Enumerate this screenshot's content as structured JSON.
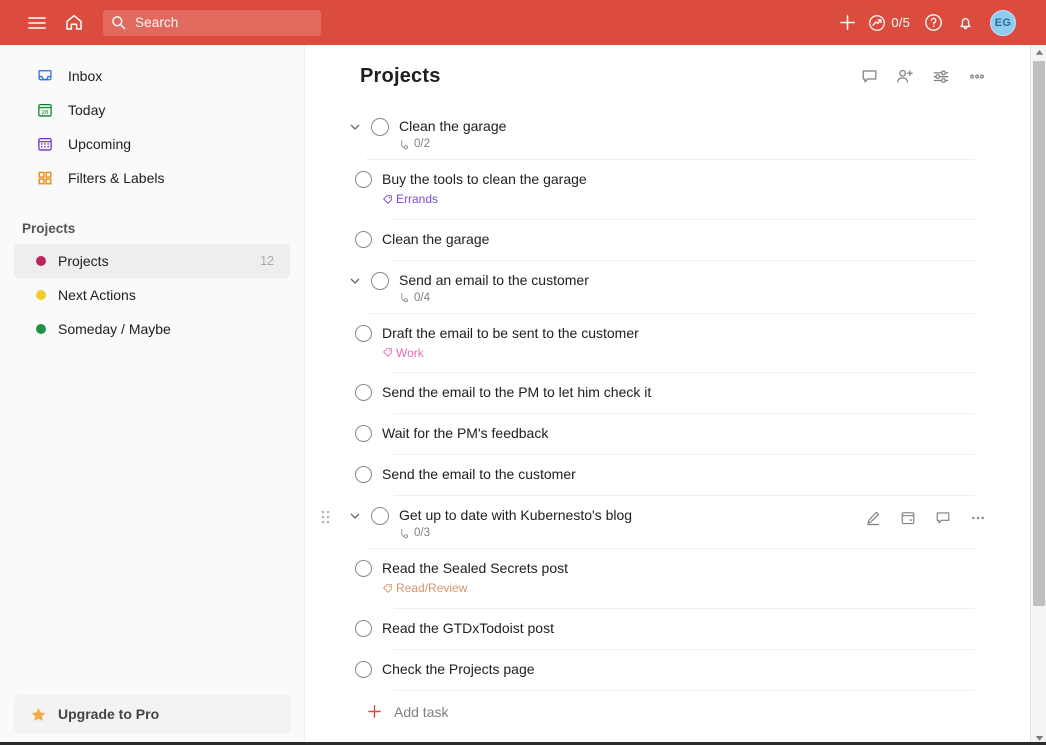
{
  "topbar": {
    "menu_icon": "hamburger-icon",
    "home_icon": "home-icon",
    "search": {
      "placeholder": "Search",
      "icon": "search-icon"
    },
    "add_icon": "plus-icon",
    "karma": {
      "icon": "productivity-icon",
      "count": "0/5"
    },
    "help_icon": "question-icon",
    "notifications_icon": "bell-icon",
    "avatar": {
      "initials": "EG"
    },
    "bg_color": "#db4c3f"
  },
  "sidebar": {
    "nav": [
      {
        "label": "Inbox",
        "icon": "inbox-icon",
        "color": "#246fe0"
      },
      {
        "label": "Today",
        "icon": "calendar-today-icon",
        "color": "#058527"
      },
      {
        "label": "Upcoming",
        "icon": "calendar-upcoming-icon",
        "color": "#692fc2"
      },
      {
        "label": "Filters & Labels",
        "icon": "filters-labels-icon",
        "color": "#eb8909"
      }
    ],
    "projects_header": "Projects",
    "projects": [
      {
        "label": "Projects",
        "count": "12",
        "color": "#b8255f",
        "active": true
      },
      {
        "label": "Next Actions",
        "count": "",
        "color": "#f3cc2c",
        "active": false
      },
      {
        "label": "Someday / Maybe",
        "count": "",
        "color": "#1f9447",
        "active": false
      }
    ],
    "upgrade": {
      "label": "Upgrade to Pro",
      "icon": "star-icon",
      "color": "#f4aa48"
    }
  },
  "main": {
    "title": "Projects",
    "header_actions": [
      {
        "name": "comments-button",
        "icon": "comment-icon"
      },
      {
        "name": "share-project-button",
        "icon": "person-add-icon"
      },
      {
        "name": "view-options-button",
        "icon": "sliders-icon"
      },
      {
        "name": "more-options-button",
        "icon": "ellipsis-icon"
      }
    ],
    "tasks": [
      {
        "title": "Clean the garage",
        "subcount": "0/2",
        "hovered": false,
        "subtasks": [
          {
            "title": "Buy the tools to clean the garage",
            "label": "Errands",
            "label_color": "#7b4ad8"
          },
          {
            "title": "Clean the garage",
            "label": "",
            "label_color": ""
          }
        ]
      },
      {
        "title": "Send an email to the customer",
        "subcount": "0/4",
        "hovered": false,
        "subtasks": [
          {
            "title": "Draft the email to be sent to the customer",
            "label": "Work",
            "label_color": "#e86ab5"
          },
          {
            "title": "Send the email to the PM to let him check it",
            "label": "",
            "label_color": ""
          },
          {
            "title": "Wait for the PM's feedback",
            "label": "",
            "label_color": ""
          },
          {
            "title": "Send the email to the customer",
            "label": "",
            "label_color": ""
          }
        ]
      },
      {
        "title": "Get up to date with Kubernesto's blog",
        "subcount": "0/3",
        "hovered": true,
        "row_actions": [
          {
            "name": "edit-task-button",
            "icon": "pencil-icon"
          },
          {
            "name": "schedule-task-button",
            "icon": "calendar-icon"
          },
          {
            "name": "comment-task-button",
            "icon": "comment-icon"
          },
          {
            "name": "task-more-button",
            "icon": "ellipsis-icon"
          }
        ],
        "subtasks": [
          {
            "title": "Read the Sealed Secrets post",
            "label": "Read/Review",
            "label_color": "#d9936a"
          },
          {
            "title": "Read the GTDxTodoist post",
            "label": "",
            "label_color": ""
          },
          {
            "title": "Check the Projects page",
            "label": "",
            "label_color": ""
          }
        ]
      }
    ],
    "add_task": {
      "label": "Add task",
      "icon": "plus-icon",
      "color": "#db4c3f"
    }
  },
  "scrollbar": {
    "up_icon": "triangle-up-icon",
    "down_icon": "triangle-down-icon"
  }
}
